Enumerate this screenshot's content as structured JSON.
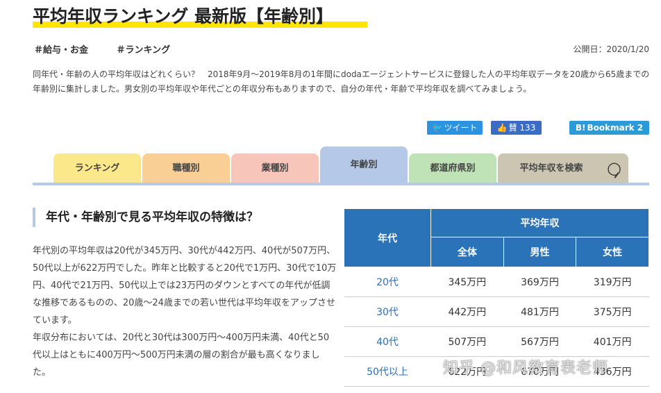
{
  "header": {
    "title": "平均年収ランキング 最新版【年齢別】",
    "tags": [
      "＃給与・お金",
      "＃ランキング"
    ],
    "published": "公開日：2020/1/20"
  },
  "intro": "同年代・年齢の人の平均年収はどれくらい？　2018年9月〜2019年8月の1年間にdodaエージェントサービスに登録した人の平均年収データを20歳から65歳までの年齢別に集計しました。男女別の平均年収や年代ごとの年収分布もありますので、自分の年代・年齢で平均年収を調べてみましょう。",
  "social": {
    "tweet": "ツイート",
    "like": "賛 133",
    "bookmark": "Bookmark 2",
    "tweet_icon": "twitter-bird-icon",
    "like_icon": "thumbs-up-icon",
    "bookmark_icon": "hatena-b-icon"
  },
  "tabs": [
    {
      "label": "ランキング",
      "color": "#fbe88b"
    },
    {
      "label": "職種別",
      "color": "#f9cf96"
    },
    {
      "label": "業種別",
      "color": "#f8c5bb"
    },
    {
      "label": "年齢別",
      "color": "#b5c8e8",
      "active": true
    },
    {
      "label": "都道府県別",
      "color": "#bfe3b6"
    },
    {
      "label": "平均年収を検索",
      "color": "#cbc5b2",
      "icon": "magnifier-icon"
    }
  ],
  "section": {
    "heading": "年代・年齢別で見る平均年収の特徴は？",
    "paragraph1": "年代別の平均年収は20代が345万円、30代が442万円、40代が507万円、50代以上が622万円でした。昨年と比較すると20代で1万円、30代で10万円、40代で21万円、50代以上では23万円のダウンとすべての年代が低調な推移であるものの、20歳〜24歳までの若い世代は平均年収をアップさせています。",
    "paragraph2": "年収分布においては、20代と30代は300万円〜400万円未満、40代と50代以上はともに400万円〜500万円未満の層の割合が最も高くなりました。"
  },
  "table": {
    "header_age": "年代",
    "header_avg": "平均年収",
    "header_all": "全体",
    "header_male": "男性",
    "header_female": "女性",
    "rows": [
      {
        "age": "20代",
        "all": "345万円",
        "male": "369万円",
        "female": "319万円"
      },
      {
        "age": "30代",
        "all": "442万円",
        "male": "481万円",
        "female": "375万円"
      },
      {
        "age": "40代",
        "all": "507万円",
        "male": "567万円",
        "female": "401万円"
      },
      {
        "age": "50代以上",
        "all": "622万円",
        "male": "670万円",
        "female": "436万円"
      }
    ]
  },
  "watermark": "知乎 @和风教育表老师",
  "colors": {
    "accent_yellow": "#ffe600",
    "table_header": "#2b73b8",
    "tab_underline": "#b5c8e8"
  }
}
